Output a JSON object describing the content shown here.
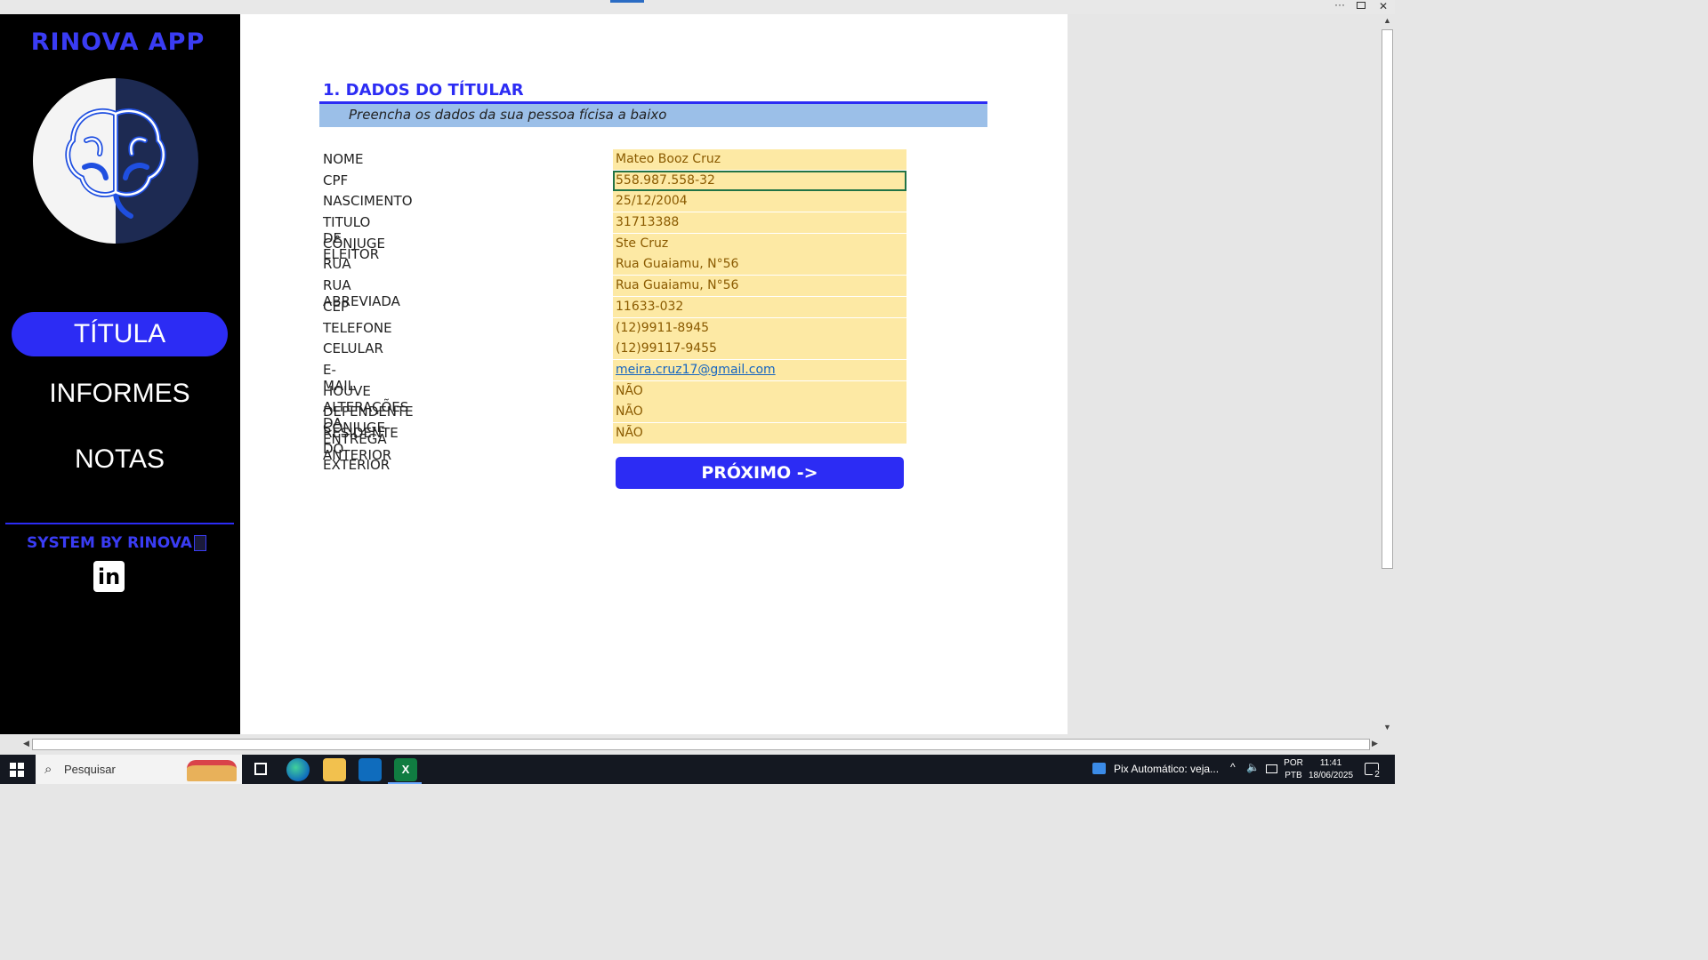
{
  "sidebar": {
    "app_title": "RINOVA APP",
    "menu": [
      {
        "label": "TÍTULA",
        "active": true
      },
      {
        "label": "INFORMES",
        "active": false
      },
      {
        "label": "NOTAS",
        "active": false
      }
    ],
    "footer": "SYSTEM BY RINOVA",
    "linkedin_label": "in"
  },
  "section": {
    "title": "1. DADOS DO TÍTULAR",
    "subtitle": "Preencha os dados da sua pessoa fícisa a baixo"
  },
  "form": {
    "rows": [
      {
        "label": "NOME",
        "value": "Mateo Booz Cruz"
      },
      {
        "label": "CPF",
        "value": "558.987.558-32"
      },
      {
        "label": "NASCIMENTO",
        "value": "25/12/2004"
      },
      {
        "label": "TITULO DE ELEITOR",
        "value": "31713388"
      },
      {
        "label": "CÔNJUGE",
        "value": "Ste Cruz"
      },
      {
        "label": "RUA",
        "value": "Rua Guaiamu, N°56"
      },
      {
        "label": "RUA ABREVIADA",
        "value": "Rua Guaiamu, N°56"
      },
      {
        "label": "CEP",
        "value": "11633-032"
      },
      {
        "label": "TELEFONE",
        "value": "(12)9911-8945"
      },
      {
        "label": "CELULAR",
        "value": "(12)99117-9455"
      },
      {
        "label": "E-MAIL",
        "value": "meira.cruz17@gmail.com"
      },
      {
        "label": "HOUVE ALTERAÇÕES DA ENTREGA ANTERIOR",
        "value": "NÃO"
      },
      {
        "label": "DEPENDENTE CÔNJUGE",
        "value": "NÃO"
      },
      {
        "label": "RESIDENTE DO EXTERIOR",
        "value": "NÃO"
      }
    ]
  },
  "next_button": "PRÓXIMO ->",
  "window_controls": {
    "more": "···"
  },
  "taskbar": {
    "search_placeholder": "Pesquisar",
    "notification": "Pix Automático: veja...",
    "lang_top": "POR",
    "lang_bottom": "PTB",
    "time": "11:41",
    "date": "18/06/2025",
    "notif_count": "2"
  },
  "colors": {
    "accent": "#2c2cf4",
    "input_fill": "#fde9a4",
    "subtitle_bar": "#9bbfe8"
  }
}
